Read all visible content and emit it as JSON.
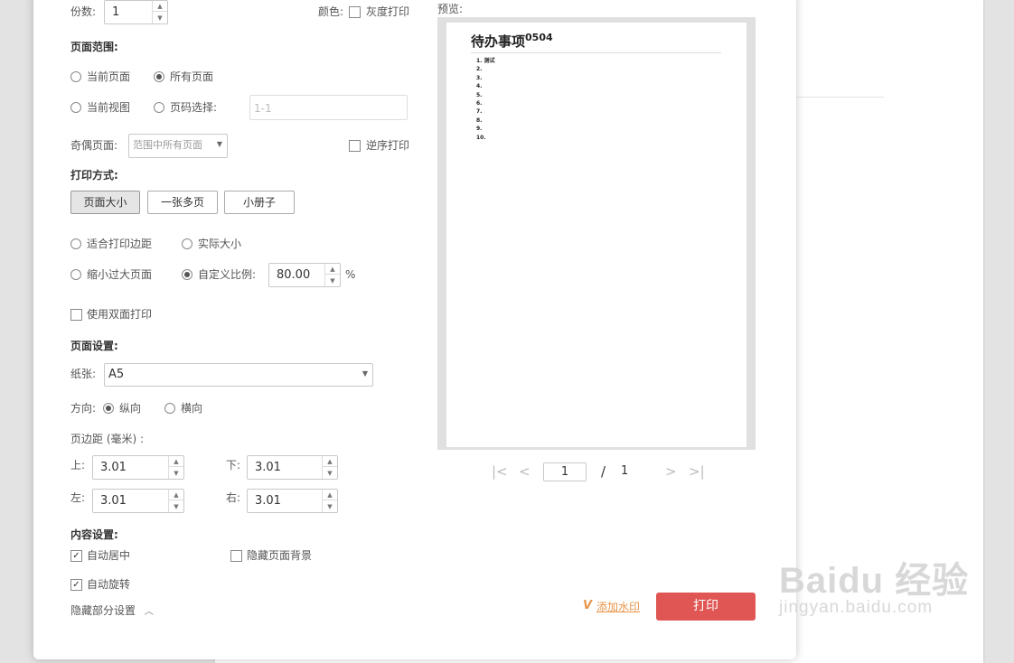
{
  "copies": {
    "label": "份数:",
    "value": "1"
  },
  "color": {
    "label": "颜色:",
    "grayscale_label": "灰度打印"
  },
  "page_range": {
    "title": "页面范围:",
    "current_page": "当前页面",
    "all_pages": "所有页面",
    "current_view": "当前视图",
    "page_select": "页码选择:",
    "page_select_placeholder": "1-1"
  },
  "odd_even": {
    "label": "奇偶页面:",
    "value": "范围中所有页面",
    "reverse_label": "逆序打印"
  },
  "print_mode": {
    "title": "打印方式:",
    "tabs": [
      "页面大小",
      "一张多页",
      "小册子"
    ],
    "fit_margins": "适合打印边距",
    "actual_size": "实际大小",
    "shrink_large": "缩小过大页面",
    "custom_scale": "自定义比例:",
    "scale_value": "80.00",
    "scale_unit": "%",
    "duplex": "使用双面打印"
  },
  "page_setup": {
    "title": "页面设置:",
    "paper_label": "纸张:",
    "paper_value": "A5",
    "orientation_label": "方向:",
    "portrait": "纵向",
    "landscape": "横向",
    "margins_label": "页边距 (毫米) :",
    "top_label": "上:",
    "top": "3.01",
    "bottom_label": "下:",
    "bottom": "3.01",
    "left_label": "左:",
    "left": "3.01",
    "right_label": "右:",
    "right": "3.01"
  },
  "content": {
    "title": "内容设置:",
    "auto_center": "自动居中",
    "hide_background": "隐藏页面背景",
    "auto_rotate": "自动旋转",
    "hide_settings": "隐藏部分设置"
  },
  "preview": {
    "label": "预览:",
    "doc_title": "待办事项",
    "doc_title_sup": "0504",
    "list": [
      "1. 测试",
      "2.",
      "3.",
      "4.",
      "5.",
      "6.",
      "7.",
      "8.",
      "9.",
      "10."
    ],
    "current_page": "1",
    "separator": "/",
    "total_pages": "1"
  },
  "footer": {
    "vip_icon": "V",
    "watermark": "添加水印",
    "print": "打印"
  },
  "baidu_watermark": {
    "main": "Baidu 经验",
    "sub": "jingyan.baidu.com"
  }
}
